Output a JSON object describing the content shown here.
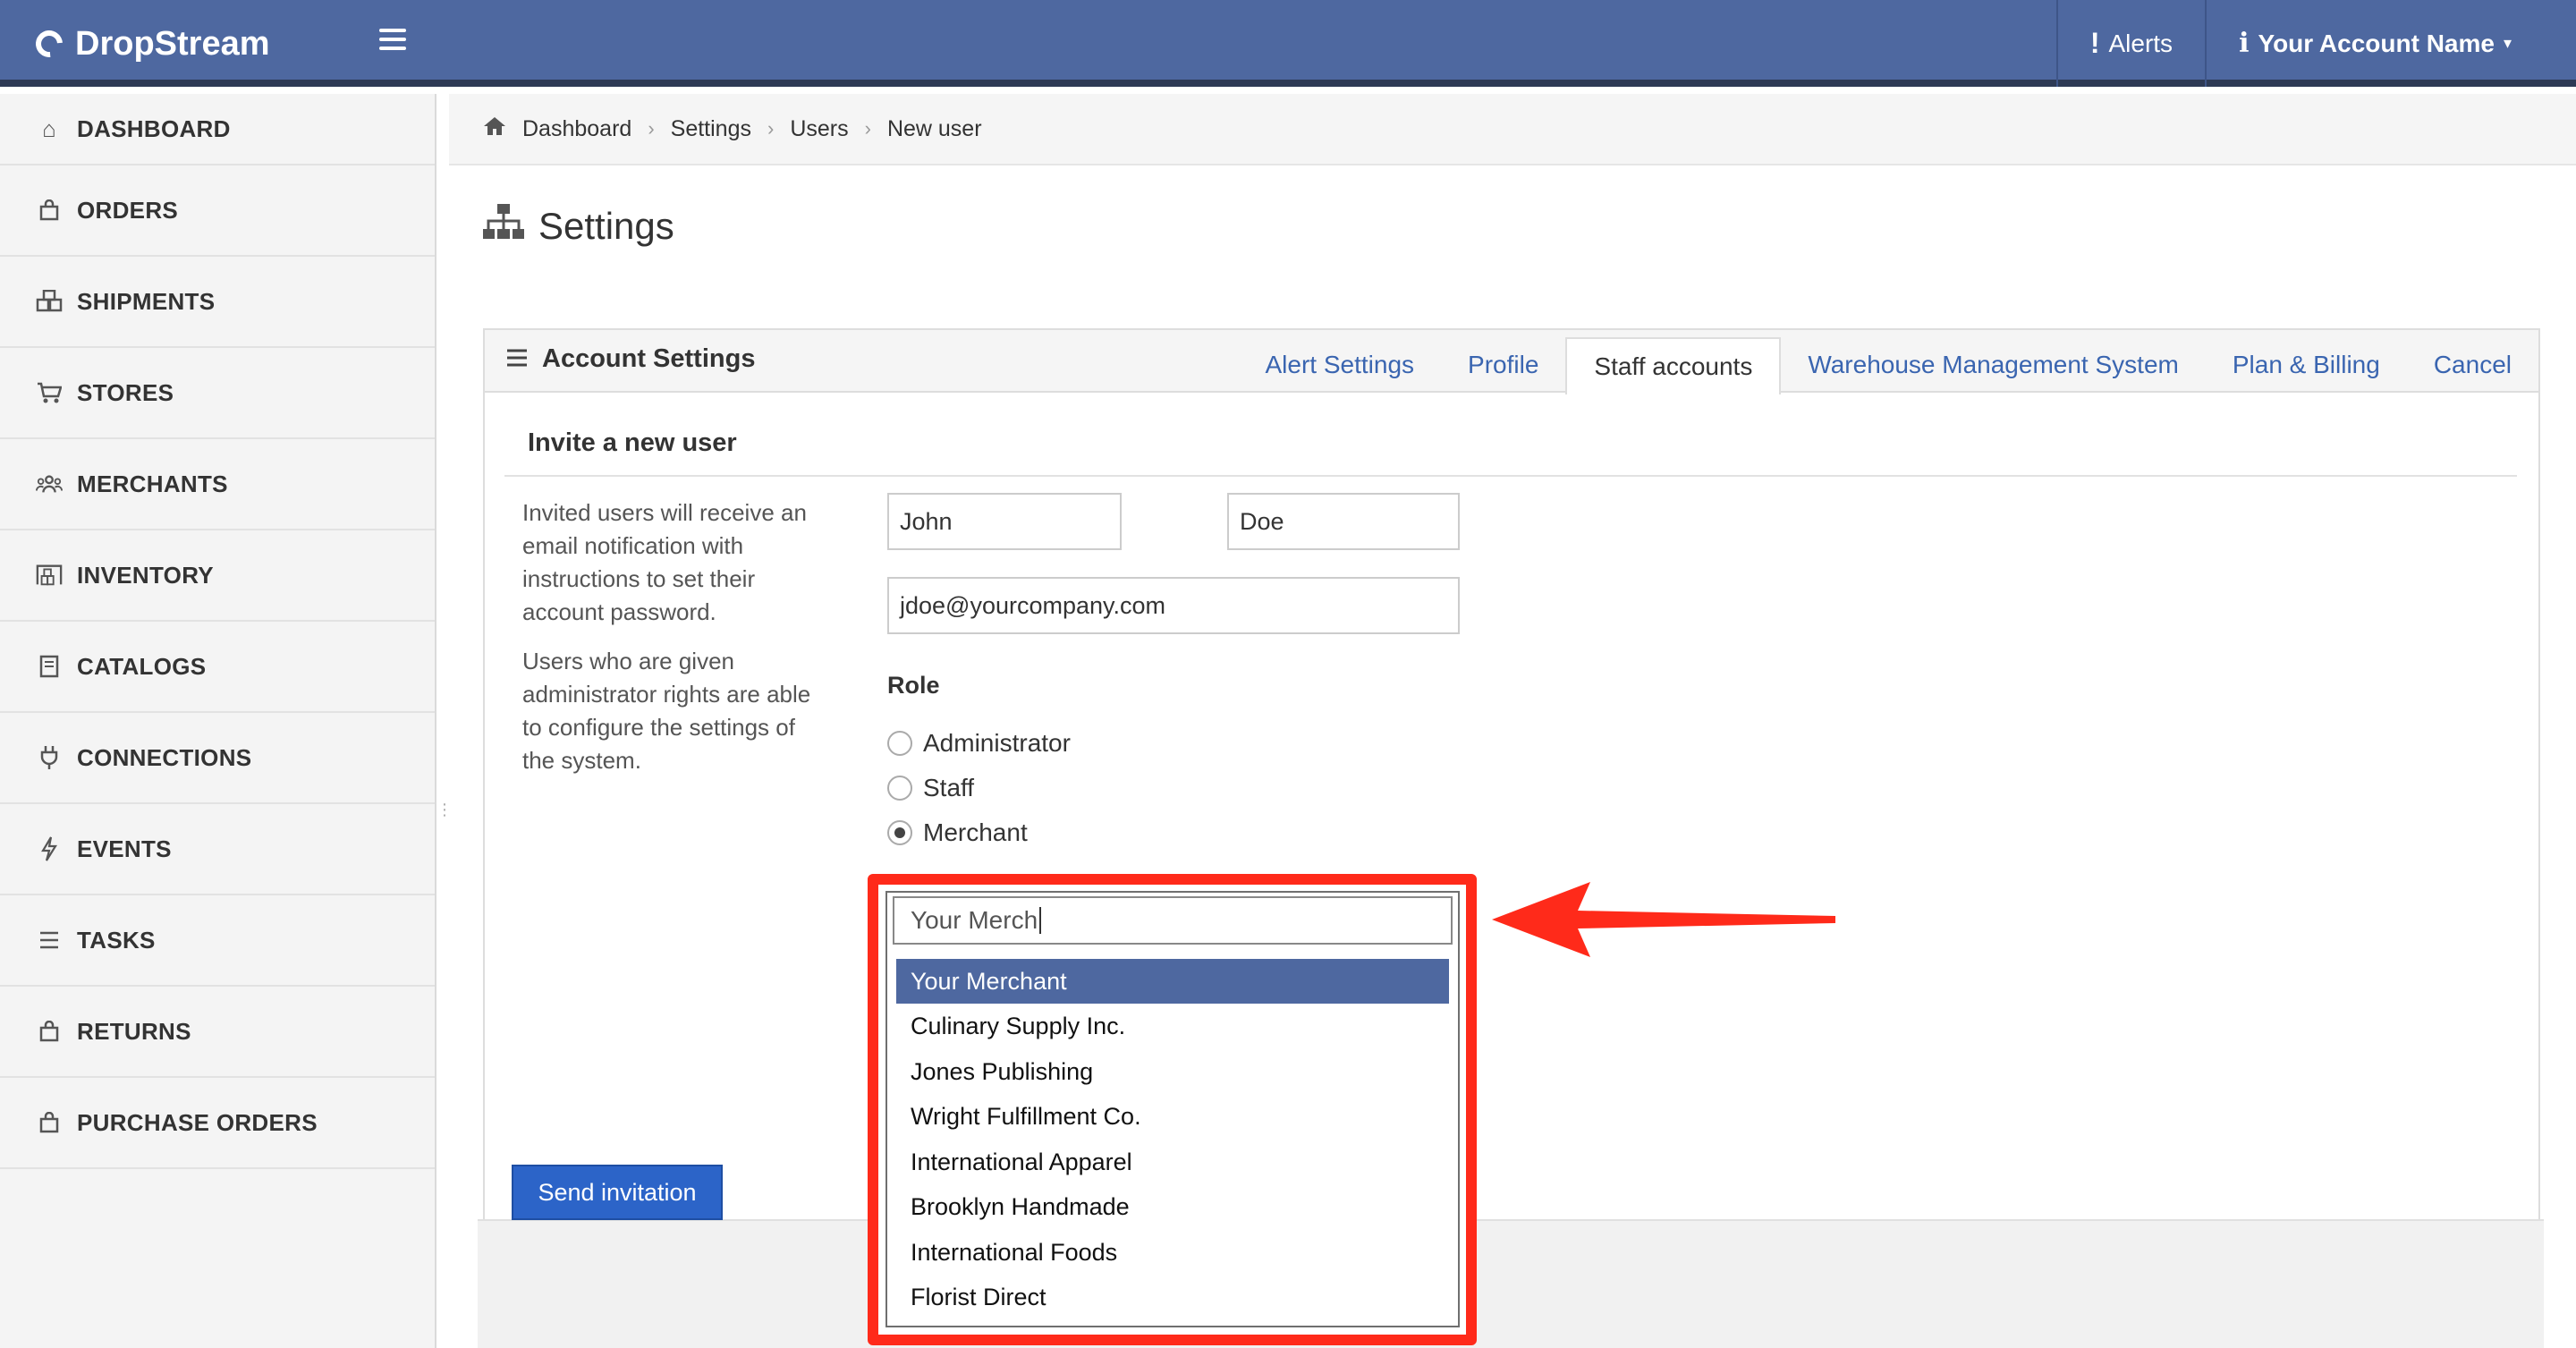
{
  "brand": {
    "name": "DropStream"
  },
  "topbar": {
    "alerts_label": "Alerts",
    "account_label": "Your Account Name"
  },
  "sidebar": {
    "items": [
      {
        "label": "DASHBOARD",
        "icon": "home-icon"
      },
      {
        "label": "ORDERS",
        "icon": "bag-icon"
      },
      {
        "label": "SHIPMENTS",
        "icon": "boxes-icon"
      },
      {
        "label": "STORES",
        "icon": "cart-icon"
      },
      {
        "label": "MERCHANTS",
        "icon": "people-icon"
      },
      {
        "label": "INVENTORY",
        "icon": "warehouse-icon"
      },
      {
        "label": "CATALOGS",
        "icon": "book-icon"
      },
      {
        "label": "CONNECTIONS",
        "icon": "plug-icon"
      },
      {
        "label": "EVENTS",
        "icon": "bolt-icon"
      },
      {
        "label": "TASKS",
        "icon": "list-icon"
      },
      {
        "label": "RETURNS",
        "icon": "bag-icon"
      },
      {
        "label": "PURCHASE ORDERS",
        "icon": "bag-icon"
      }
    ]
  },
  "breadcrumb": [
    "Dashboard",
    "Settings",
    "Users",
    "New user"
  ],
  "page": {
    "title": "Settings"
  },
  "panel": {
    "title": "Account Settings",
    "tabs": [
      "Alert Settings",
      "Profile",
      "Staff accounts",
      "Warehouse Management System",
      "Plan & Billing",
      "Cancel"
    ],
    "active_tab": "Staff accounts"
  },
  "form": {
    "section_title": "Invite a new user",
    "help_1": "Invited users will receive an email notification with instructions to set their account password.",
    "help_2": "Users who are given administrator rights are able to configure the settings of the system.",
    "first_name": "John",
    "last_name": "Doe",
    "email": "jdoe@yourcompany.com",
    "role_label": "Role",
    "roles": [
      "Administrator",
      "Staff",
      "Merchant"
    ],
    "selected_role": "Merchant",
    "submit_label": "Send invitation"
  },
  "merchant_dropdown": {
    "query": "Your Merch",
    "options": [
      "Your Merchant",
      "Culinary Supply Inc.",
      "Jones Publishing",
      "Wright Fulfillment Co.",
      "International Apparel",
      "Brooklyn Handmade",
      "International Foods",
      "Florist Direct"
    ],
    "highlighted": "Your Merchant"
  },
  "colors": {
    "topbar": "#4e68a0",
    "annotation": "#ff2a1a",
    "link": "#3a65b0",
    "button": "#2c64c8"
  }
}
